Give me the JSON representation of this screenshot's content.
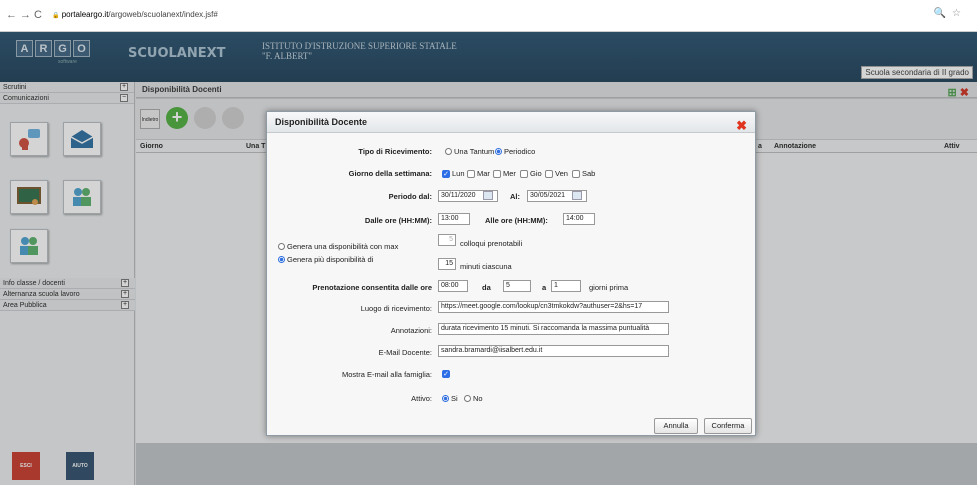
{
  "browser": {
    "url_domain": "portaleargo.it",
    "url_path": "/argoweb/scuolanext/index.jsf#",
    "back": "←",
    "forward": "→",
    "reload": "C",
    "lock": "🔒",
    "zoom": "🔍",
    "star": "☆"
  },
  "header": {
    "logo_letters": [
      "A",
      "R",
      "G",
      "O"
    ],
    "logo_sub": "software",
    "app_name": "SCUOLANEXT",
    "school_line1": "ISTITUTO D'ISTRUZIONE SUPERIORE STATALE",
    "school_line2": "\"F. ALBERT\"",
    "school_level": "Scuola secondaria di II grado"
  },
  "sidebar": {
    "sections_top": [
      {
        "label": "Scrutini",
        "toggle": "+"
      },
      {
        "label": "Comunicazioni",
        "toggle": "−"
      }
    ],
    "sections_bottom": [
      {
        "label": "Info classe / docenti",
        "toggle": "+"
      },
      {
        "label": "Alternanza scuola lavoro",
        "toggle": "+"
      },
      {
        "label": "Area Pubblica",
        "toggle": "+"
      }
    ],
    "exit_label": "ESCI",
    "help_label": "AIUTO"
  },
  "main": {
    "title": "Disponibilità Docenti",
    "toolbar_label": "Indietro",
    "columns": {
      "giorno": "Giorno",
      "una": "Una T",
      "ora": "a",
      "annotazione": "Annotazione",
      "attiv": "Attiv"
    }
  },
  "dialog": {
    "title": "Disponibilità Docente",
    "close": "✖",
    "tipo_label": "Tipo di Ricevimento:",
    "tipo_options": [
      "Una Tantum",
      "Periodico"
    ],
    "giorno_label": "Giorno della settimana:",
    "giorni": [
      "Lun",
      "Mar",
      "Mer",
      "Gio",
      "Ven",
      "Sab"
    ],
    "periodo_label": "Periodo dal:",
    "periodo_dal": "30/11/2020",
    "al_label": "Al:",
    "periodo_al": "30/05/2021",
    "dalle_label": "Dalle ore (HH:MM):",
    "dalle_value": "13:00",
    "alle_label": "Alle ore (HH:MM):",
    "alle_value": "14:00",
    "genera_max_label": "Genera una disponibilità con max",
    "max_value": "5",
    "colloqui_label": "colloqui prenotabili",
    "genera_piu_label": "Genera più disponibilità di",
    "minuti_value": "15",
    "minuti_label": "minuti ciascuna",
    "prenotazione_label": "Prenotazione consentita dalle ore",
    "prenotazione_ore": "08:00",
    "da_label": "da",
    "da_value": "5",
    "a_label": "a",
    "a_value": "1",
    "giorni_prima_label": "giorni prima",
    "luogo_label": "Luogo di ricevimento:",
    "luogo_value": "https://meet.google.com/lookup/cn3tmkokdw?authuser=2&hs=17",
    "annotazioni_label": "Annotazioni:",
    "annotazioni_value": "durata ricevimento 15 minuti. Si raccomanda la massima puntualità",
    "email_label": "E-Mail Docente:",
    "email_value": "sandra.bramardi@iisalbert.edu.it",
    "mostra_label": "Mostra E-mail alla famiglia:",
    "attivo_label": "Attivo:",
    "attivo_options": [
      "Si",
      "No"
    ],
    "annulla": "Annulla",
    "conferma": "Conferma"
  }
}
